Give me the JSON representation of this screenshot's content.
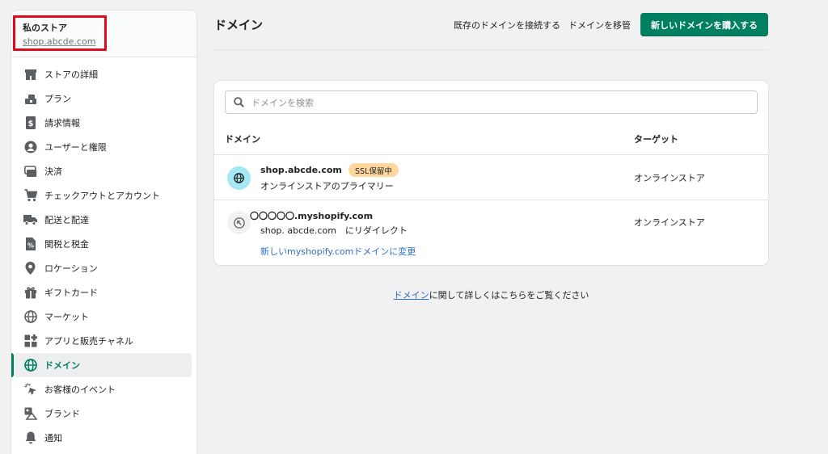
{
  "store": {
    "name": "私のストア",
    "domain": "shop.abcde.com"
  },
  "sidebar": {
    "items": [
      {
        "label": "ストアの詳細",
        "icon": "store-icon"
      },
      {
        "label": "プラン",
        "icon": "plan-icon"
      },
      {
        "label": "請求情報",
        "icon": "billing-icon"
      },
      {
        "label": "ユーザーと権限",
        "icon": "user-icon"
      },
      {
        "label": "決済",
        "icon": "payments-icon"
      },
      {
        "label": "チェックアウトとアカウント",
        "icon": "cart-icon"
      },
      {
        "label": "配送と配達",
        "icon": "truck-icon"
      },
      {
        "label": "関税と税金",
        "icon": "tax-icon"
      },
      {
        "label": "ロケーション",
        "icon": "location-pin-icon"
      },
      {
        "label": "ギフトカード",
        "icon": "gift-icon"
      },
      {
        "label": "マーケット",
        "icon": "globe-icon"
      },
      {
        "label": "アプリと販売チャネル",
        "icon": "apps-icon"
      },
      {
        "label": "ドメイン",
        "icon": "domain-globe-icon",
        "active": true
      },
      {
        "label": "お客様のイベント",
        "icon": "cursor-click-icon"
      },
      {
        "label": "ブランド",
        "icon": "brand-icon"
      },
      {
        "label": "通知",
        "icon": "bell-icon"
      }
    ]
  },
  "header": {
    "title": "ドメイン",
    "connect_label": "既存のドメインを接続する",
    "transfer_label": "ドメインを移管",
    "buy_label": "新しいドメインを購入する"
  },
  "search": {
    "placeholder": "ドメインを検索"
  },
  "table": {
    "col_domain": "ドメイン",
    "col_target": "ターゲット",
    "rows": [
      {
        "name": "shop.abcde.com",
        "badge": "SSL保留中",
        "sub": "オンラインストアのプライマリー",
        "target": "オンラインストア"
      },
      {
        "name": "〇〇〇〇〇.myshopify.com",
        "sub": "shop. abcde.com　にリダイレクト",
        "link": "新しいmyshopify.comドメインに変更",
        "target": "オンラインストア"
      }
    ]
  },
  "footer": {
    "link": "ドメイン",
    "text": "に関して詳しくはこちらをご覧ください"
  },
  "colors": {
    "accent": "#008060",
    "link": "#2c6ecb",
    "badge": "#ffd79d",
    "highlight": "#e00b1c"
  }
}
